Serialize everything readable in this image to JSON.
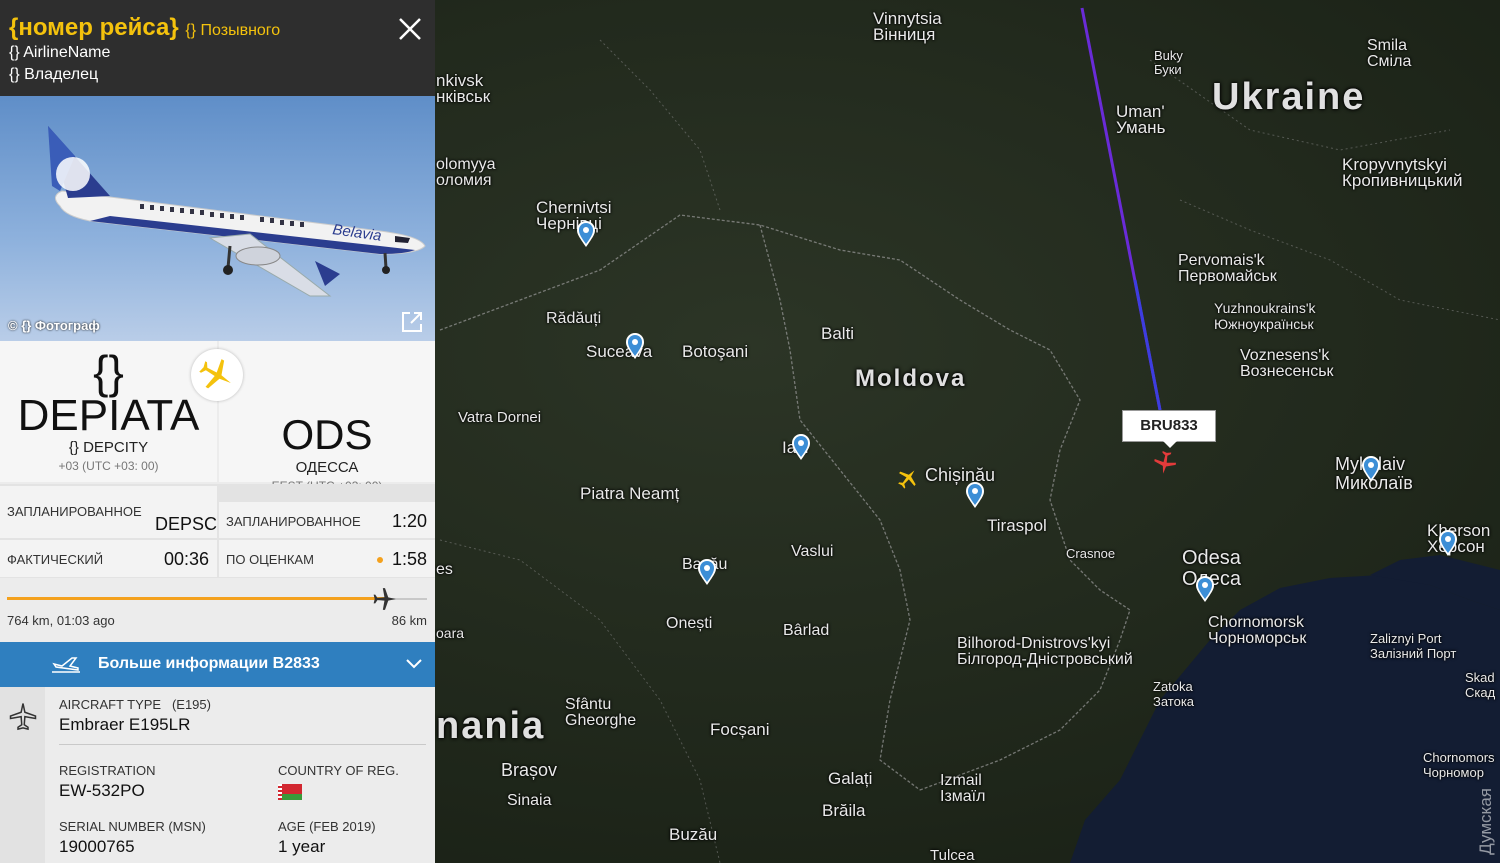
{
  "panel": {
    "flight_number": "{номер рейса}",
    "callsign": "{} Позывного",
    "airline": "{} AirlineName",
    "owner": "{} Владелец",
    "photo_credit": "© {} Фотограф",
    "aircraft_livery_text": "Belavia",
    "departure": {
      "brace": "{}",
      "code": "DEPIATA",
      "city": "{} DEPCITY",
      "timezone": "+03 (UTC +03: 00)"
    },
    "arrival": {
      "code": "ODS",
      "city": "ОДЕССА",
      "timezone": "EEST (UTC +03: 00)"
    },
    "times": {
      "scheduled_label": "ЗАПЛАНИРОВАННОЕ",
      "dep_scheduled_value": "DEPSC",
      "arr_scheduled_value": "1:20",
      "actual_label": "ФАКТИЧЕСКИЙ",
      "actual_value": "00:36",
      "estimated_label": "ПО ОЦЕНКАМ",
      "estimated_value": "1:58"
    },
    "progress": {
      "flown_text": "764 km, 01:03 ago",
      "remaining_text": "86 km",
      "fraction": 0.9
    },
    "more_info": "Больше информации B2833",
    "aircraft_type_label": "AIRCRAFT TYPE",
    "aircraft_type_code": "(E195)",
    "aircraft_type_value": "Embraer E195LR",
    "registration_label": "REGISTRATION",
    "registration_value": "EW-532PO",
    "country_label": "COUNTRY OF REG.",
    "msn_label": "SERIAL NUMBER (MSN)",
    "msn_value": "19000765",
    "age_label": "AGE (FEB 2019)",
    "age_value": "1 year"
  },
  "map": {
    "flight_label": "BRU833",
    "countries": {
      "ukraine": "Ukraine",
      "moldova": "Moldova",
      "romania": "nania"
    },
    "cities": {
      "vinnytsia": [
        "Vinnytsia",
        "Вінниця"
      ],
      "buky": [
        "Buky",
        "Буки"
      ],
      "smila": [
        "Smila",
        "Сміла"
      ],
      "khmelnytskyi": [
        "nkivsk",
        "нківськ"
      ],
      "uman": [
        "Uman'",
        "Умань"
      ],
      "kolomyya": [
        "olomyya",
        "оломия"
      ],
      "kropyvnytskyi": [
        "Kropyvnytskyi",
        "Кропивницький"
      ],
      "chernivtsi": [
        "Chernivtsi",
        "Чернівці"
      ],
      "pervomaisk": [
        "Pervomais'k",
        "Первомайськ"
      ],
      "radauti": [
        "Rădăuți"
      ],
      "yuzhnoukrainsk": [
        "Yuzhnoukrains'k",
        "Южноукраїнськ"
      ],
      "balti": [
        "Balti"
      ],
      "suceava": [
        "Suceava"
      ],
      "botosani": [
        "Botoşani"
      ],
      "voznesensk": [
        "Voznesens'k",
        "Вознесенськ"
      ],
      "vatra": [
        "Vatra Dornei"
      ],
      "iasi": [
        "Iași"
      ],
      "mykolaiv": [
        "Mykolaiv",
        "Миколаїв"
      ],
      "chisinau": [
        "Chișinău"
      ],
      "piatra": [
        "Piatra Neamț"
      ],
      "tiraspol": [
        "Tiraspol"
      ],
      "kherson": [
        "Kherson",
        "Херсон"
      ],
      "vaslui": [
        "Vaslui"
      ],
      "crasnoe": [
        "Crasnoe"
      ],
      "odesa": [
        "Odesa",
        "Одеса"
      ],
      "bacau": [
        "Bacău"
      ],
      "onesti": [
        "Onești"
      ],
      "barlad": [
        "Bârlad"
      ],
      "chornomorsk": [
        "Chornomorsk",
        "Чорноморськ"
      ],
      "bilhorod": [
        "Bilhorod-Dnistrovs'kyi",
        "Білгород-Дністровський"
      ],
      "zalizny": [
        "Zaliznyi Port",
        "Залізний Порт"
      ],
      "skad": [
        "Skad",
        "Скад"
      ],
      "zatoka": [
        "Zatoka",
        "Затока"
      ],
      "sfantu": [
        "Sfântu",
        "Gheorghe"
      ],
      "focsani": [
        "Focșani"
      ],
      "brasov": [
        "Brașov"
      ],
      "sinaia": [
        "Sinaia"
      ],
      "galati": [
        "Galați"
      ],
      "izmail": [
        "Izmail",
        "Ізмаїл"
      ],
      "braila": [
        "Brăila"
      ],
      "buzau": [
        "Buzău"
      ],
      "tulcea": [
        "Tulcea"
      ],
      "chornomorske": [
        "Chornomors",
        "Чорномор"
      ],
      "oara": [
        "oara"
      ],
      "es": [
        "es"
      ]
    },
    "watermark": "Думская"
  },
  "colors": {
    "header_bg": "#2e2e2e",
    "accent_yellow": "#f4c20d",
    "more_info_bg": "#2f7fbf",
    "route_line": "#6a2bd8",
    "plane_on_map": "#e23b3b"
  }
}
